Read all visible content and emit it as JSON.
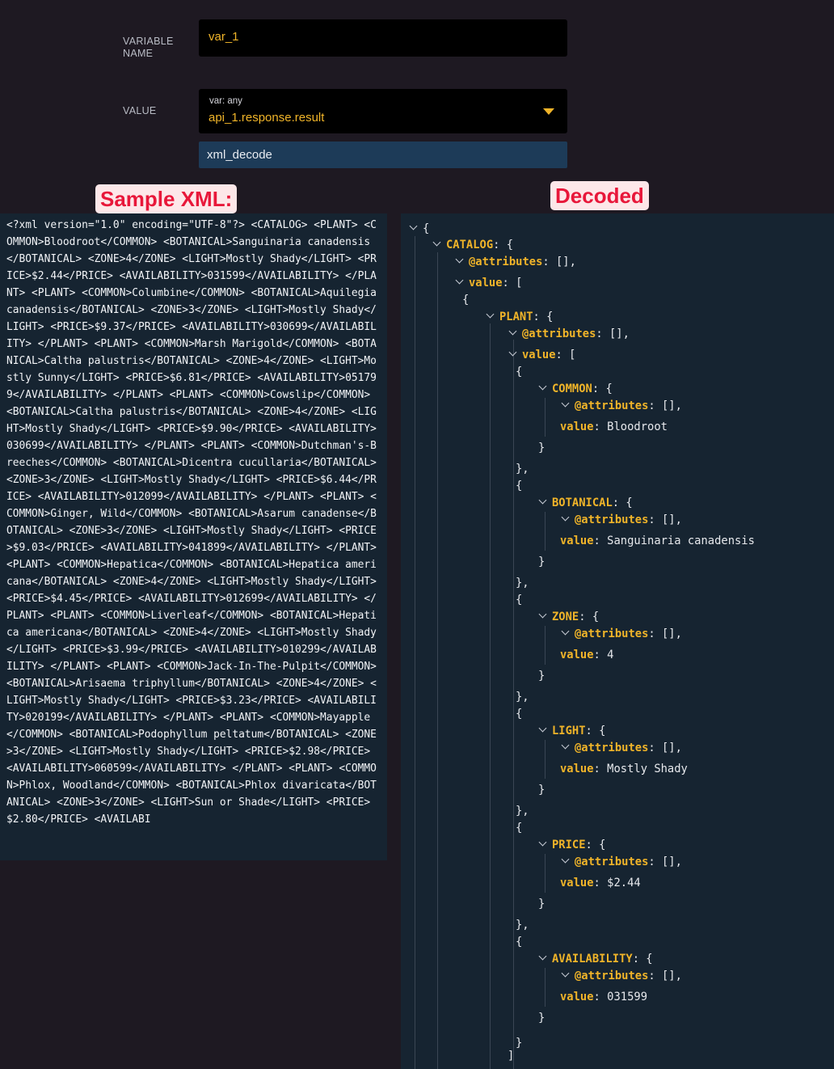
{
  "form": {
    "variable_name_label": "VARIABLE NAME",
    "variable_name_value": "var_1",
    "value_label": "VALUE",
    "value_type": "var: any",
    "value_expression": "api_1.response.result",
    "transform": "xml_decode"
  },
  "annotations": {
    "left": "Sample XML:",
    "right": "Decoded"
  },
  "xml_sample": "<?xml version=\"1.0\" encoding=\"UTF-8\"?> <CATALOG> <PLANT> <COMMON>Bloodroot</COMMON> <BOTANICAL>Sanguinaria canadensis</BOTANICAL> <ZONE>4</ZONE> <LIGHT>Mostly Shady</LIGHT> <PRICE>$2.44</PRICE> <AVAILABILITY>031599</AVAILABILITY> </PLANT> <PLANT> <COMMON>Columbine</COMMON> <BOTANICAL>Aquilegia canadensis</BOTANICAL> <ZONE>3</ZONE> <LIGHT>Mostly Shady</LIGHT> <PRICE>$9.37</PRICE> <AVAILABILITY>030699</AVAILABILITY> </PLANT> <PLANT> <COMMON>Marsh Marigold</COMMON> <BOTANICAL>Caltha palustris</BOTANICAL> <ZONE>4</ZONE> <LIGHT>Mostly Sunny</LIGHT> <PRICE>$6.81</PRICE> <AVAILABILITY>051799</AVAILABILITY> </PLANT> <PLANT> <COMMON>Cowslip</COMMON> <BOTANICAL>Caltha palustris</BOTANICAL> <ZONE>4</ZONE> <LIGHT>Mostly Shady</LIGHT> <PRICE>$9.90</PRICE> <AVAILABILITY>030699</AVAILABILITY> </PLANT> <PLANT> <COMMON>Dutchman's-Breeches</COMMON> <BOTANICAL>Dicentra cucullaria</BOTANICAL> <ZONE>3</ZONE> <LIGHT>Mostly Shady</LIGHT> <PRICE>$6.44</PRICE> <AVAILABILITY>012099</AVAILABILITY> </PLANT> <PLANT> <COMMON>Ginger, Wild</COMMON> <BOTANICAL>Asarum canadense</BOTANICAL> <ZONE>3</ZONE> <LIGHT>Mostly Shady</LIGHT> <PRICE>$9.03</PRICE> <AVAILABILITY>041899</AVAILABILITY> </PLANT> <PLANT> <COMMON>Hepatica</COMMON> <BOTANICAL>Hepatica americana</BOTANICAL> <ZONE>4</ZONE> <LIGHT>Mostly Shady</LIGHT> <PRICE>$4.45</PRICE> <AVAILABILITY>012699</AVAILABILITY> </PLANT> <PLANT> <COMMON>Liverleaf</COMMON> <BOTANICAL>Hepatica americana</BOTANICAL> <ZONE>4</ZONE> <LIGHT>Mostly Shady</LIGHT> <PRICE>$3.99</PRICE> <AVAILABILITY>010299</AVAILABILITY> </PLANT> <PLANT> <COMMON>Jack-In-The-Pulpit</COMMON> <BOTANICAL>Arisaema triphyllum</BOTANICAL> <ZONE>4</ZONE> <LIGHT>Mostly Shady</LIGHT> <PRICE>$3.23</PRICE> <AVAILABILITY>020199</AVAILABILITY> </PLANT> <PLANT> <COMMON>Mayapple</COMMON> <BOTANICAL>Podophyllum peltatum</BOTANICAL> <ZONE>3</ZONE> <LIGHT>Mostly Shady</LIGHT> <PRICE>$2.98</PRICE> <AVAILABILITY>060599</AVAILABILITY> </PLANT> <PLANT> <COMMON>Phlox, Woodland</COMMON> <BOTANICAL>Phlox divaricata</BOTANICAL> <ZONE>3</ZONE> <LIGHT>Sun or Shade</LIGHT> <PRICE>$2.80</PRICE> <AVAILABI",
  "decoded": {
    "open_brace": "{",
    "close_brace": "}",
    "close_brace_comma": "},",
    "close_bracket": "]",
    "catalog_key": "CATALOG",
    "plant_key": "PLANT",
    "attributes_key": "@attributes",
    "attributes_value": "[],",
    "value_key": "value",
    "array_open": "[",
    "obj_suffix": ": {",
    "colon": ": ",
    "fields": [
      {
        "key": "COMMON",
        "value": "Bloodroot"
      },
      {
        "key": "BOTANICAL",
        "value": "Sanguinaria canadensis"
      },
      {
        "key": "ZONE",
        "value": "4"
      },
      {
        "key": "LIGHT",
        "value": "Mostly Shady"
      },
      {
        "key": "PRICE",
        "value": "$2.44"
      },
      {
        "key": "AVAILABILITY",
        "value": "031599"
      }
    ]
  }
}
